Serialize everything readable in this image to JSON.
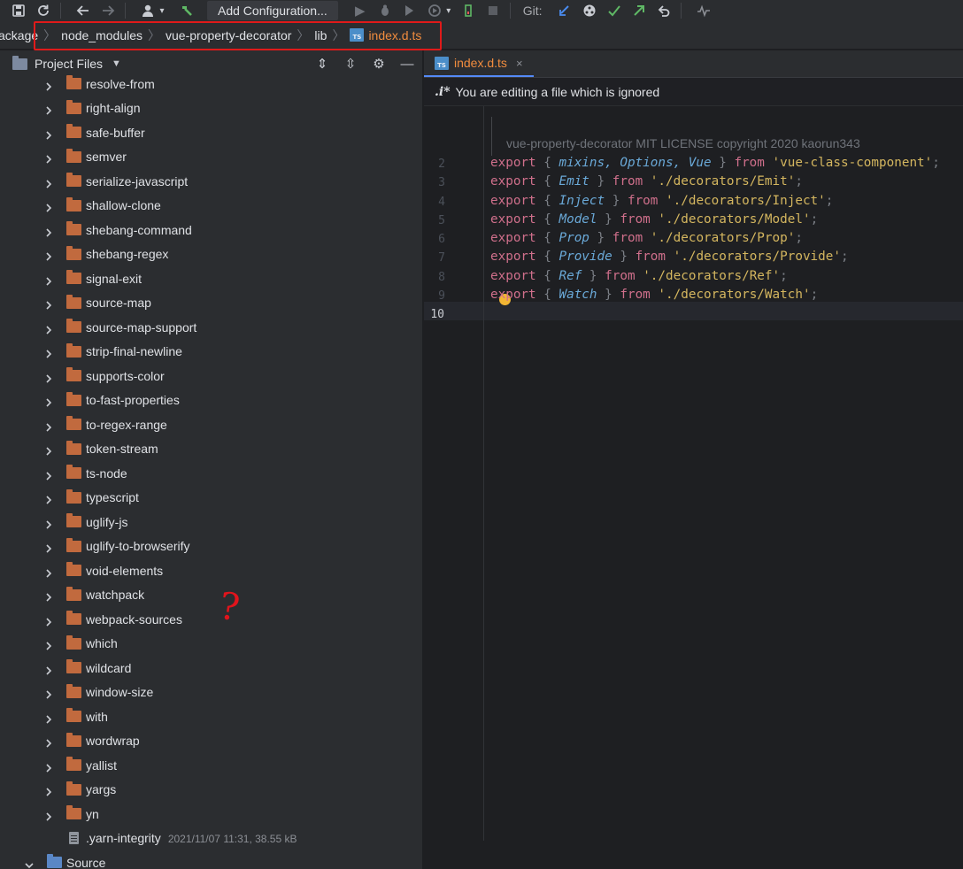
{
  "toolbar": {
    "add_configuration": "Add Configuration...",
    "git_label": "Git:"
  },
  "breadcrumb": {
    "items": [
      "ackage",
      "node_modules",
      "vue-property-decorator",
      "lib"
    ],
    "file": "index.d.ts"
  },
  "project": {
    "title": "Project Files",
    "folders": [
      "resolve-from",
      "right-align",
      "safe-buffer",
      "semver",
      "serialize-javascript",
      "shallow-clone",
      "shebang-command",
      "shebang-regex",
      "signal-exit",
      "source-map",
      "source-map-support",
      "strip-final-newline",
      "supports-color",
      "to-fast-properties",
      "to-regex-range",
      "token-stream",
      "ts-node",
      "typescript",
      "uglify-js",
      "uglify-to-browserify",
      "void-elements",
      "watchpack",
      "webpack-sources",
      "which",
      "wildcard",
      "window-size",
      "with",
      "wordwrap",
      "yallist",
      "yargs",
      "yn"
    ],
    "file": {
      "name": ".yarn-integrity",
      "meta": "2021/11/07 11:31, 38.55 kB"
    },
    "source_folder": "Source",
    "annotation": "?"
  },
  "editor": {
    "tab": "index.d.ts",
    "tab_close": "×",
    "notice_icon": ".i*",
    "notice": "You are editing a file which is ignored",
    "doc_comment": "vue-property-decorator MIT LICENSE copyright 2020 kaorun343",
    "line_numbers": [
      "2",
      "3",
      "4",
      "5",
      "6",
      "7",
      "8",
      "9",
      "10"
    ],
    "lines": [
      {
        "names": "mixins, Options, Vue",
        "path": "'vue-class-component'"
      },
      {
        "names": "Emit",
        "path": "'./decorators/Emit'"
      },
      {
        "names": "Inject",
        "path": "'./decorators/Inject'"
      },
      {
        "names": "Model",
        "path": "'./decorators/Model'"
      },
      {
        "names": "Prop",
        "path": "'./decorators/Prop'"
      },
      {
        "names": "Provide",
        "path": "'./decorators/Provide'"
      },
      {
        "names": "Ref",
        "path": "'./decorators/Ref'"
      },
      {
        "names": "Watch",
        "path": "'./decorators/Watch'"
      }
    ],
    "keyword_export": "export",
    "keyword_from": "from"
  }
}
